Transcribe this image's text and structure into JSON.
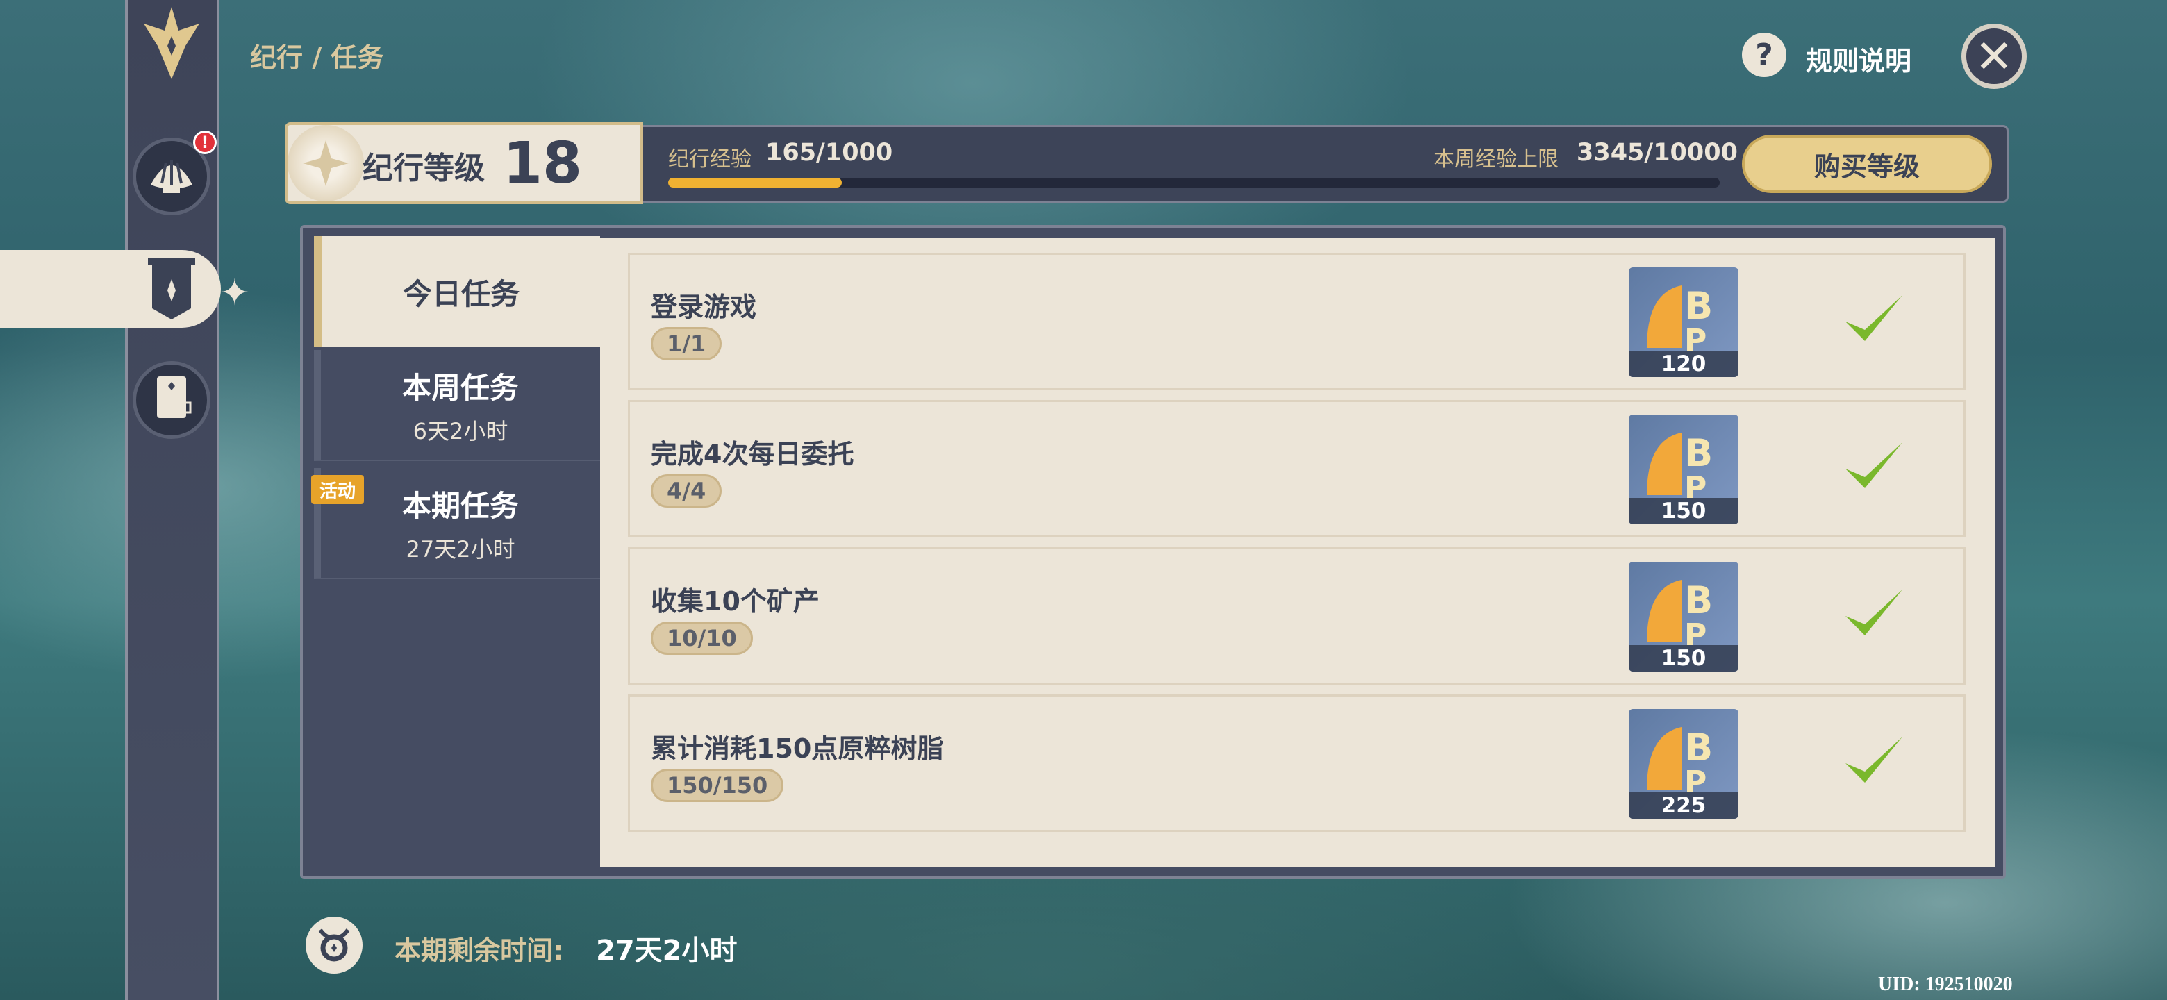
{
  "breadcrumb": "纪行 / 任务",
  "help": {
    "icon": "question-mark-icon",
    "label": "规则说明"
  },
  "close": {
    "icon": "close-icon"
  },
  "sidebar": {
    "items": [
      {
        "name": "wish-shell",
        "icon": "shell-icon",
        "badge": "!"
      },
      {
        "name": "missions",
        "icon": "banner-icon",
        "active": true
      },
      {
        "name": "notes",
        "icon": "document-icon"
      }
    ]
  },
  "level": {
    "label": "纪行等级",
    "value": "18",
    "exp_label": "纪行经验",
    "exp_value": "165/1000",
    "exp_fraction": 0.165,
    "cap_label": "本周经验上限",
    "cap_value": "3345/10000",
    "buy_label": "购买等级"
  },
  "tabs": [
    {
      "title": "今日任务",
      "sub": ""
    },
    {
      "title": "本周任务",
      "sub": "6天2小时"
    },
    {
      "title": "本期任务",
      "sub": "27天2小时",
      "badge": "活动"
    }
  ],
  "tasks": [
    {
      "name": "登录游戏",
      "progress": "1/1",
      "reward": "120",
      "completed": true
    },
    {
      "name": "完成4次每日委托",
      "progress": "4/4",
      "reward": "150",
      "completed": true
    },
    {
      "name": "收集10个矿产",
      "progress": "10/10",
      "reward": "150",
      "completed": true
    },
    {
      "name": "累计消耗150点原粹树脂",
      "progress": "150/150",
      "reward": "225",
      "completed": true
    }
  ],
  "footer": {
    "remain_label": "本期剩余时间:",
    "remain_value": "27天2小时",
    "uid": "UID: 192510020"
  },
  "colors": {
    "accent_gold": "#f0b232",
    "panel_dark": "#454c62",
    "paper": "#ece5d8",
    "check_green": "#7ab82c"
  }
}
